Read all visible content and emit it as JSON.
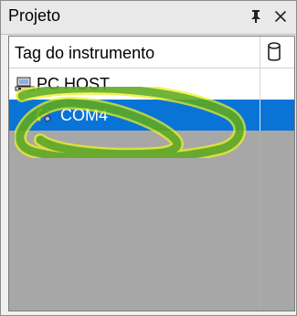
{
  "panel": {
    "title": "Projeto",
    "pin_icon": "pin-icon",
    "close_icon": "close-icon"
  },
  "table": {
    "columns": [
      {
        "label": "Tag do instrumento"
      },
      {
        "label": "",
        "icon": "cylinder-icon"
      }
    ],
    "rows": [
      {
        "label": "PC HOST",
        "icon": "computer-icon",
        "selected": false
      },
      {
        "label": "COM4",
        "icon": "com-port-icon",
        "selected": true
      }
    ]
  },
  "colors": {
    "selection": "#0a74d6",
    "panel_bg": "#a7a7a7",
    "highlight": "#f2f000"
  }
}
